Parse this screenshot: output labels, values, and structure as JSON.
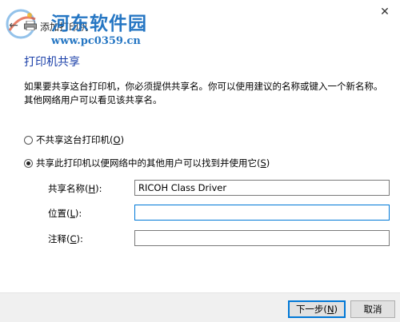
{
  "window": {
    "title": "添加打印机",
    "close_glyph": "✕"
  },
  "watermark": {
    "name": "河东软件园",
    "url": "www.pc0359.cn"
  },
  "page": {
    "heading": "打印机共享",
    "description": "如果要共享这台打印机，你必须提供共享名。你可以使用建议的名称或键入一个新名称。其他网络用户可以看见该共享名。"
  },
  "options": {
    "no_share": {
      "label": "不共享这台打印机(",
      "key": "O",
      "label_end": ")",
      "checked": false
    },
    "share": {
      "label": "共享此打印机以便网络中的其他用户可以找到并使用它(",
      "key": "S",
      "label_end": ")",
      "checked": true
    }
  },
  "fields": {
    "share_name": {
      "label": "共享名称(",
      "key": "H",
      "label_end": "):",
      "value": "RICOH Class Driver"
    },
    "location": {
      "label": "位置(",
      "key": "L",
      "label_end": "):",
      "value": ""
    },
    "comment": {
      "label": "注释(",
      "key": "C",
      "label_end": "):",
      "value": ""
    }
  },
  "buttons": {
    "next": {
      "label": "下一步(",
      "key": "N",
      "label_end": ")"
    },
    "cancel": {
      "label": "取消"
    }
  },
  "colors": {
    "heading": "#1a3fa8",
    "watermark": "#1a6fc0",
    "focus_border": "#0078d7"
  },
  "icons": {
    "back": "back-arrow-icon",
    "printer": "printer-icon",
    "close": "close-icon"
  }
}
